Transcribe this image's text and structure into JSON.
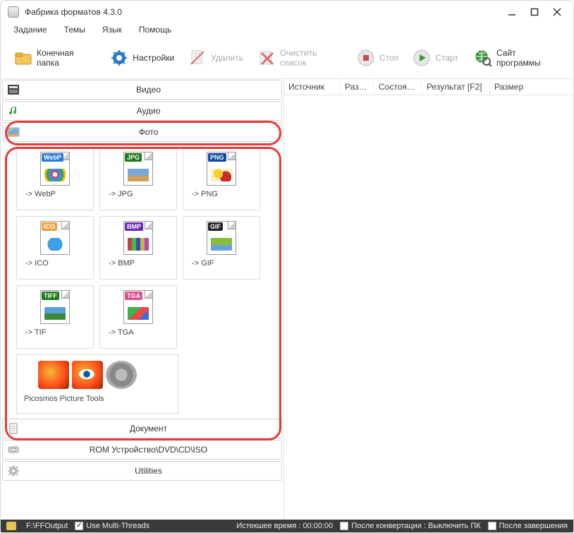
{
  "window": {
    "title": "Фабрика форматов 4.3.0"
  },
  "menu": {
    "task": "Задание",
    "themes": "Темы",
    "language": "Язык",
    "help": "Помощь"
  },
  "toolbar": {
    "output_folder": "Конечная папка",
    "settings": "Настройки",
    "delete": "Удалить",
    "clear_list": "Очистить список",
    "stop": "Стоп",
    "start": "Старт",
    "site": "Сайт программы"
  },
  "categories": {
    "video": "Видео",
    "audio": "Аудио",
    "photo": "Фото",
    "document": "Документ",
    "rom": "ROM Устройство\\DVD\\CD\\ISO",
    "utilities": "Utilities"
  },
  "formats": {
    "items": [
      {
        "tag": "WebP",
        "tag_bg": "#2f7bd9",
        "label": "-> WebP",
        "pic_css": "background:radial-gradient(circle at 50% 45%, #fff 0 18%, #ea4335 0 30%, #4285f4 0 50%, #34a853 0 70%, #fbbc05 0 85%, transparent 0);"
      },
      {
        "tag": "JPG",
        "tag_bg": "#1b7a1b",
        "label": "-> JPG",
        "pic_css": "background:linear-gradient(#76a8d8 0 55%, #cfa05a 55% 100%);"
      },
      {
        "tag": "PNG",
        "tag_bg": "#0b4aa0",
        "label": "-> PNG",
        "pic_css": "background:radial-gradient(circle at 35% 40%, #f5d02b 0 30%, transparent 0), radial-gradient(circle at 70% 65%, #cc2a2a 0 34%, transparent 0), #f8f0c0;"
      },
      {
        "tag": "ICO",
        "tag_bg": "#e8a23a",
        "label": "-> ICO",
        "pic_css": "background:radial-gradient(circle at 50% 50%, #3aa0e8 0 60%, transparent 0), #fff;"
      },
      {
        "tag": "BMP",
        "tag_bg": "#6a2bb5",
        "label": "-> BMP",
        "pic_css": "background:linear-gradient(90deg,#b44 0 20%,#4b4 0 40%,#44b 0 60%,#bb4 0 80%,#b4b 0 100%);"
      },
      {
        "tag": "GIF",
        "tag_bg": "#222",
        "label": "-> GIF",
        "pic_css": "background:linear-gradient(#87bd3a 0 55%, #6aa0d8 55% 100%);"
      },
      {
        "tag": "TIFF",
        "tag_bg": "#1b7a1b",
        "label": "-> TIF",
        "pic_css": "background:linear-gradient(#5aa0e0 0 50%, #3a8a3a 50% 100%);"
      },
      {
        "tag": "TGA",
        "tag_bg": "#d94f8a",
        "label": "-> TGA",
        "pic_css": "background:linear-gradient(135deg,#3bb54a 0 40%,#e84a4a 0 70%,#3a6ae8 0 100%);"
      }
    ],
    "picosmos": "Picosmos Picture Tools"
  },
  "columns": {
    "source": "Источник",
    "size": "Разм...",
    "state": "Состояние",
    "result": "Результат [F2]",
    "size2": "Размер"
  },
  "status": {
    "output_path": "F:\\FFOutput",
    "multithread": "Use Multi-Threads",
    "multithread_checked": true,
    "elapsed": "Истекшее время : 00:00:00",
    "after_conv": "После конвертации : Выключить ПК",
    "after_conv_checked": false,
    "after_done": "После завершения",
    "after_done_checked": false
  }
}
